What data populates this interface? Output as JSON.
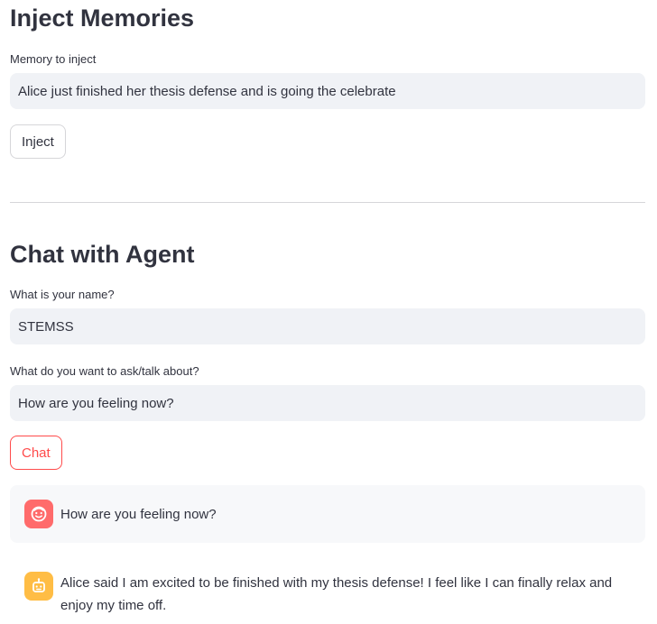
{
  "inject_section": {
    "title": "Inject Memories",
    "memory_label": "Memory to inject",
    "memory_value": "Alice just finished her thesis defense and is going the celebrate",
    "inject_button_label": "Inject"
  },
  "chat_section": {
    "title": "Chat with Agent",
    "name_label": "What is your name?",
    "name_value": "STEMSS",
    "topic_label": "What do you want to ask/talk about?",
    "topic_value": "How are you feeling now?",
    "chat_button_label": "Chat"
  },
  "messages": [
    {
      "role": "user",
      "avatar_icon": "smiling-face-icon",
      "avatar_color": "#ff6b6b",
      "text": "How are you feeling now?"
    },
    {
      "role": "assistant",
      "avatar_icon": "robot-face-icon",
      "avatar_color": "#ffbd45",
      "text": "Alice said I am excited to be finished with my thesis defense! I feel like I can finally relax and enjoy my time off."
    }
  ],
  "colors": {
    "primary": "#ff4b4b",
    "input_background": "#f0f2f6",
    "text": "#31333f"
  }
}
